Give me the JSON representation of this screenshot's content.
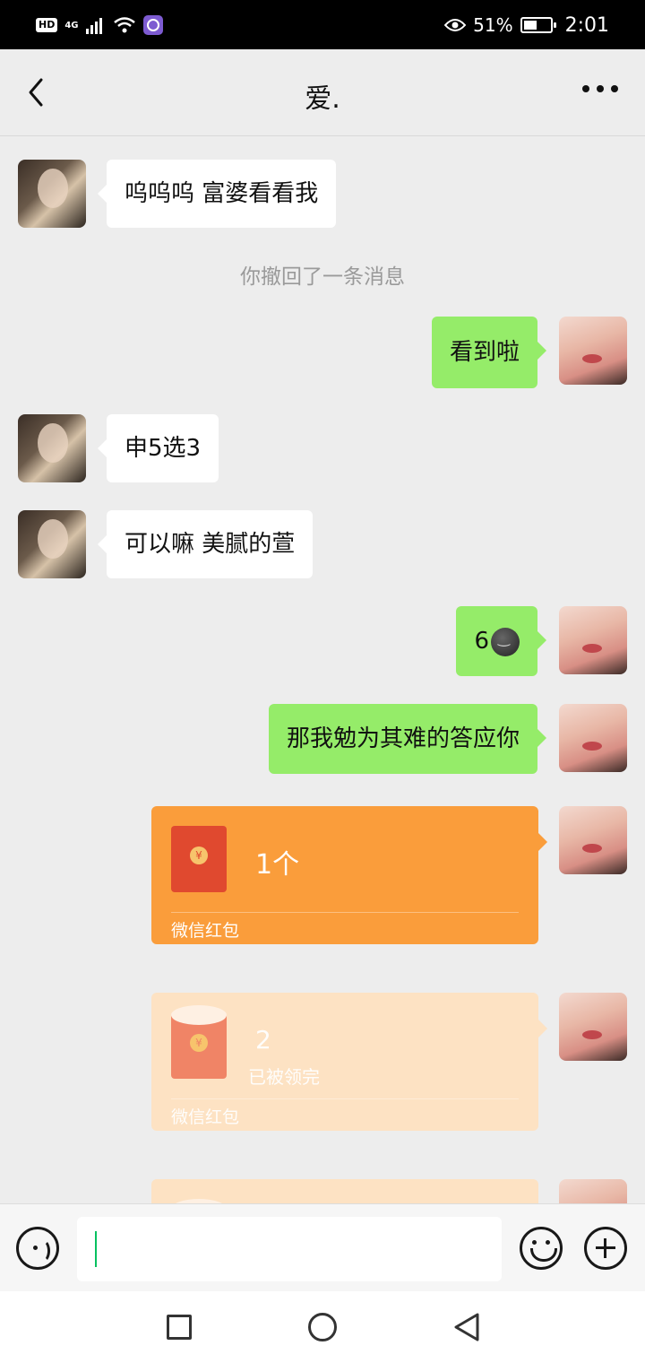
{
  "status_bar": {
    "hd": "HD",
    "network": "4G",
    "battery_percent": "51%",
    "battery_level": 0.51,
    "time": "2:01"
  },
  "header": {
    "title": "爱."
  },
  "messages": [
    {
      "side": "left",
      "text": "呜呜呜 富婆看看我"
    },
    {
      "type": "system",
      "text": "你撤回了一条消息"
    },
    {
      "side": "right",
      "text": "看到啦"
    },
    {
      "side": "left",
      "text": "申5选3"
    },
    {
      "side": "left",
      "text": "可以嘛 美腻的萱"
    },
    {
      "side": "right",
      "text": "6",
      "emoji": "smirk-emoji"
    },
    {
      "side": "right",
      "text": "那我勉为其难的答应你"
    }
  ],
  "red_packets": [
    {
      "title": "1个",
      "status": "",
      "label": "微信红包",
      "state": "unopened",
      "color": "#fa9d3b"
    },
    {
      "title": "2",
      "status": "已被领完",
      "label": "微信红包",
      "state": "claimed",
      "color": "#fde2c3"
    }
  ],
  "coin_symbol": "¥",
  "input": {
    "value": "",
    "accent": "#07c160"
  },
  "colors": {
    "green_bubble": "#95ec69",
    "background": "#ededed"
  }
}
